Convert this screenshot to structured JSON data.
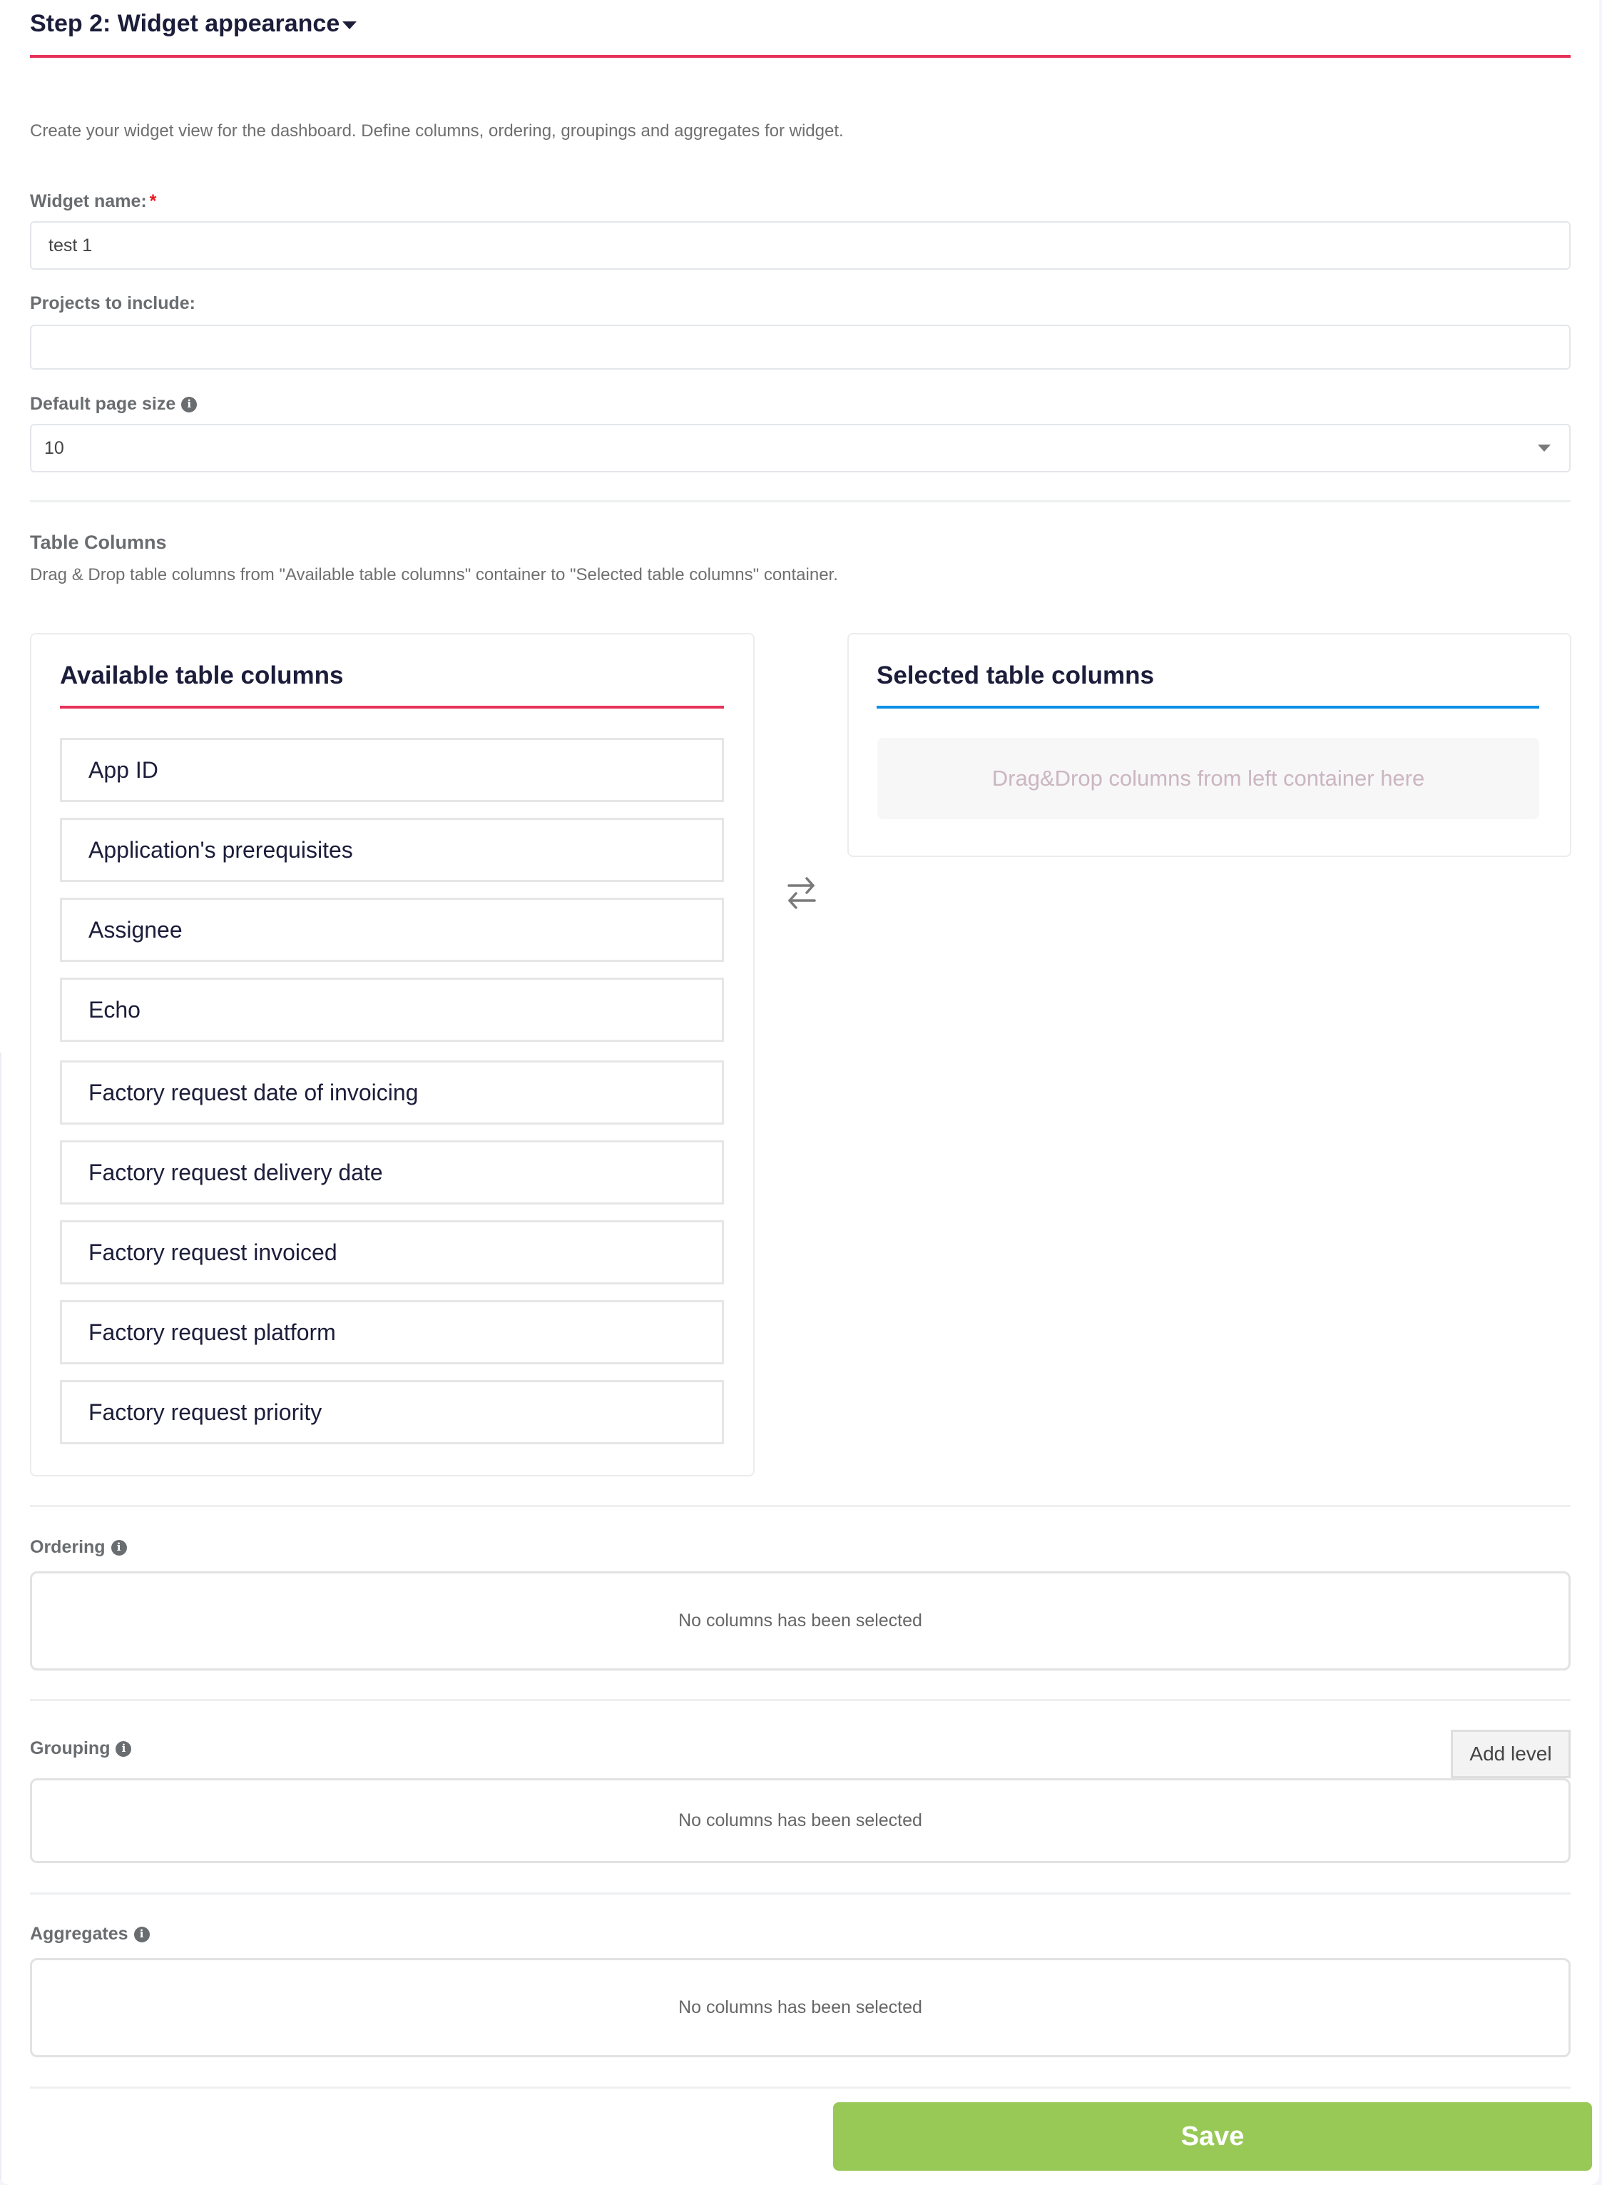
{
  "header": {
    "title": "Step 2: Widget appearance",
    "accent_color": "#e7325a"
  },
  "description": "Create your widget view for the dashboard. Define columns, ordering, groupings and aggregates for widget.",
  "form": {
    "widget_name": {
      "label": "Widget name:",
      "required_mark": "*",
      "value": "test 1"
    },
    "projects": {
      "label": "Projects to include:",
      "value": ""
    },
    "page_size": {
      "label": "Default page size",
      "value": "10"
    }
  },
  "table_columns": {
    "title": "Table Columns",
    "help": "Drag & Drop table columns from \"Available table columns\" container to \"Selected table columns\" container.",
    "available": {
      "title": "Available table columns",
      "accent_color": "#e7325a",
      "items": [
        "App ID",
        "Application's prerequisites",
        "Assignee",
        "Echo",
        "Factory request date of invoicing",
        "Factory request delivery date",
        "Factory request invoiced",
        "Factory request platform",
        "Factory request priority"
      ]
    },
    "selected": {
      "title": "Selected table columns",
      "accent_color": "#0a8fe6",
      "placeholder": "Drag&Drop columns from left container here"
    }
  },
  "ordering": {
    "label": "Ordering",
    "empty_text": "No columns has been selected"
  },
  "grouping": {
    "label": "Grouping",
    "add_level_label": "Add level",
    "empty_text": "No columns has been selected"
  },
  "aggregates": {
    "label": "Aggregates",
    "empty_text": "No columns has been selected"
  },
  "save_label": "Save",
  "save_color": "#98c957"
}
